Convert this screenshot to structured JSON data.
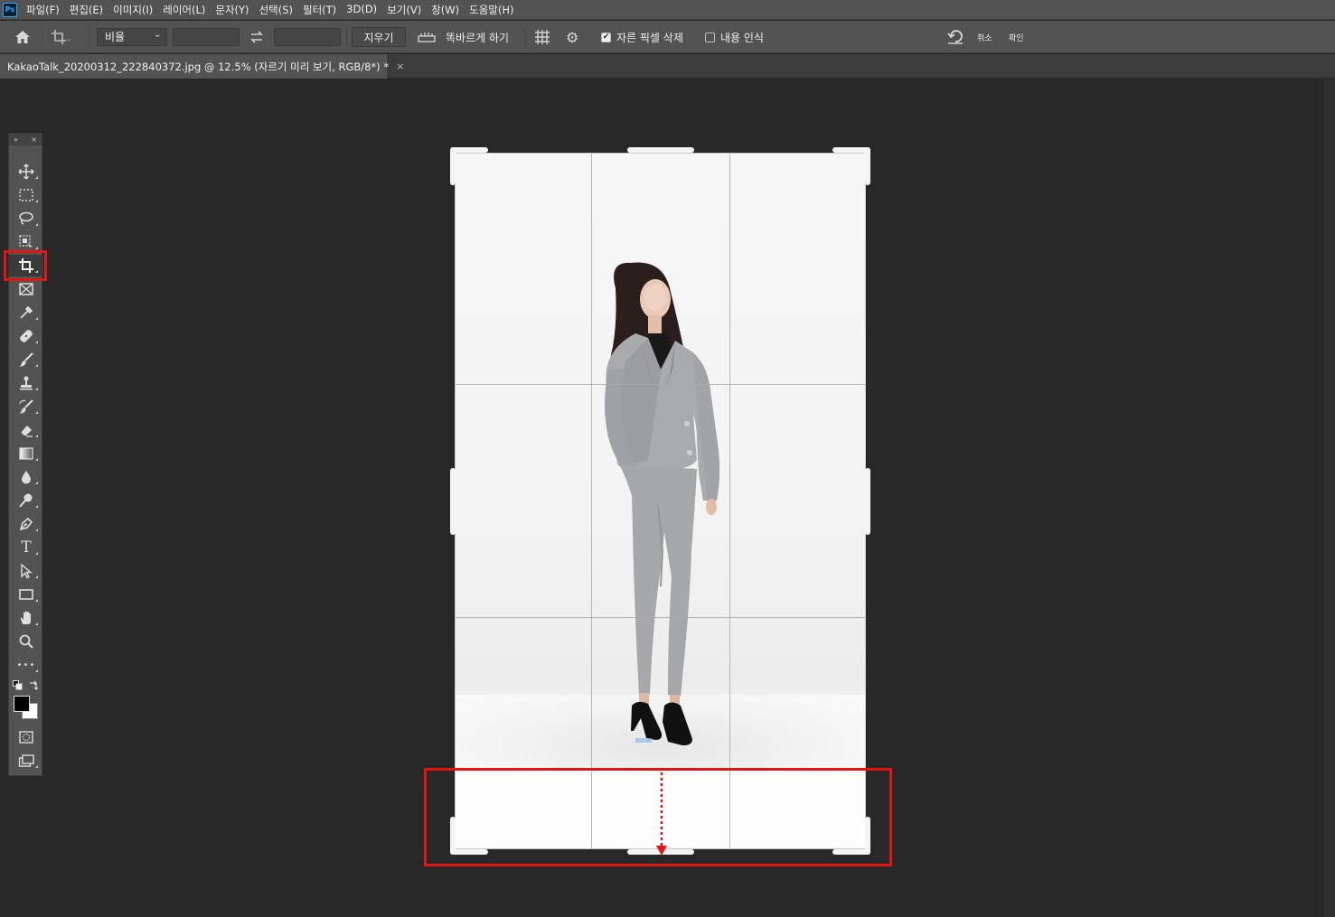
{
  "menu": {
    "logo": "Ps",
    "items": [
      "파일(F)",
      "편집(E)",
      "이미지(I)",
      "레이어(L)",
      "문자(Y)",
      "선택(S)",
      "필터(T)",
      "3D(D)",
      "보기(V)",
      "창(W)",
      "도움말(H)"
    ]
  },
  "options": {
    "ratio_select": "비율",
    "clear_button": "지우기",
    "straighten_label": "똑바르게 하기",
    "delete_cropped_label": "자른 픽셀 삭제",
    "delete_cropped_checked": true,
    "content_aware_label": "내용 인식",
    "content_aware_checked": false,
    "cancel_label": "취소",
    "confirm_label": "확인"
  },
  "document": {
    "tab_title": "KakaoTalk_20200312_222840372.jpg @ 12.5% (자르기 미리 보기, RGB/8*) *",
    "close_glyph": "×"
  },
  "toolbar": {
    "collapse_glyph": "»",
    "close_glyph": "×",
    "tools": [
      {
        "name": "move-tool",
        "icon": "move-icon"
      },
      {
        "name": "marquee-tool",
        "icon": "rect-marquee-icon"
      },
      {
        "name": "lasso-tool",
        "icon": "lasso-icon"
      },
      {
        "name": "object-select-tool",
        "icon": "object-select-icon"
      },
      {
        "name": "crop-tool",
        "icon": "crop-icon",
        "active": true
      },
      {
        "name": "frame-tool",
        "icon": "frame-icon"
      },
      {
        "name": "eyedropper-tool",
        "icon": "eyedropper-icon"
      },
      {
        "name": "healing-tool",
        "icon": "bandage-icon"
      },
      {
        "name": "brush-tool",
        "icon": "brush-icon"
      },
      {
        "name": "stamp-tool",
        "icon": "stamp-icon"
      },
      {
        "name": "history-brush-tool",
        "icon": "history-brush-icon"
      },
      {
        "name": "eraser-tool",
        "icon": "eraser-icon"
      },
      {
        "name": "gradient-tool",
        "icon": "gradient-icon"
      },
      {
        "name": "blur-tool",
        "icon": "drop-icon"
      },
      {
        "name": "dodge-tool",
        "icon": "dodge-icon"
      },
      {
        "name": "pen-tool",
        "icon": "pen-icon"
      },
      {
        "name": "type-tool",
        "icon": "type-icon"
      },
      {
        "name": "path-select-tool",
        "icon": "arrow-icon"
      },
      {
        "name": "shape-tool",
        "icon": "rectangle-icon"
      },
      {
        "name": "hand-tool",
        "icon": "hand-icon"
      },
      {
        "name": "zoom-tool",
        "icon": "magnifier-icon"
      },
      {
        "name": "more-tools",
        "icon": "ellipsis-icon"
      }
    ],
    "type_glyph": "T",
    "more_glyph": "•••",
    "foreground_color": "#000000",
    "background_color": "#ffffff"
  },
  "colors": {
    "annotation": "#e31414",
    "crop_handle": "#f4f4f4"
  }
}
